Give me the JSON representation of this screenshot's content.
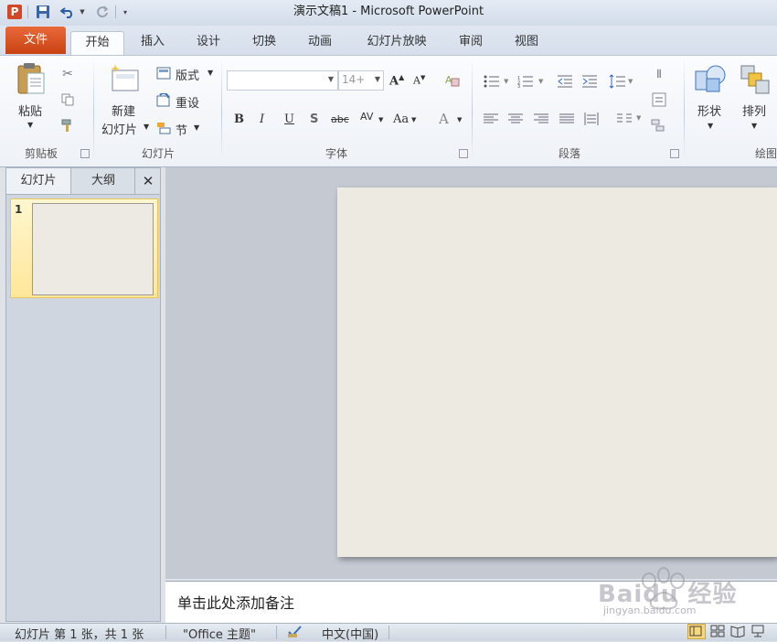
{
  "window": {
    "title": "演示文稿1 - Microsoft PowerPoint",
    "app_icon": "P"
  },
  "tabs": [
    "文件",
    "开始",
    "插入",
    "设计",
    "切换",
    "动画",
    "幻灯片放映",
    "审阅",
    "视图"
  ],
  "ribbon": {
    "clipboard": {
      "paste": "粘贴",
      "label": "剪贴板"
    },
    "slides": {
      "new_line1": "新建",
      "new_line2": "幻灯片",
      "layout": "版式",
      "reset": "重设",
      "section": "节",
      "label": "幻灯片"
    },
    "font": {
      "size": "14+",
      "label": "字体",
      "bold": "B",
      "italic": "I",
      "underline": "U",
      "shadow": "S",
      "strike": "abc",
      "spacing": "AV",
      "case": "Aa",
      "color": "A"
    },
    "paragraph": {
      "label": "段落"
    },
    "drawing": {
      "shapes": "形状",
      "arrange": "排列",
      "label": "绘图"
    }
  },
  "left_pane": {
    "tab_slides": "幻灯片",
    "tab_outline": "大纲",
    "close": "✕",
    "slide_number": "1"
  },
  "notes": {
    "placeholder": "单击此处添加备注"
  },
  "status": {
    "slide_info": "幻灯片 第 1 张，共 1 张",
    "theme": "\"Office 主题\"",
    "language": "中文(中国)"
  },
  "watermark": {
    "brand": "Baidu 经验",
    "url": "jingyan.baidu.com"
  },
  "colors": {
    "file_tab": "#d8531f",
    "slide_bg": "#eceae1",
    "workspace": "#c5cad2"
  }
}
